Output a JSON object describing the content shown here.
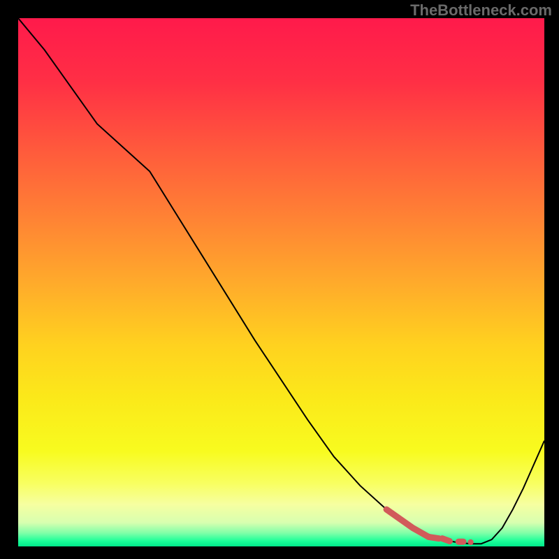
{
  "watermark": "TheBottleneck.com",
  "chart_data": {
    "type": "line",
    "title": "",
    "xlabel": "",
    "ylabel": "",
    "xlim": [
      0,
      100
    ],
    "ylim": [
      0,
      100
    ],
    "series": [
      {
        "name": "curve",
        "color": "#000000",
        "x": [
          0,
          5,
          10,
          15,
          20,
          25,
          30,
          35,
          40,
          45,
          50,
          55,
          60,
          65,
          70,
          75,
          80,
          82,
          84,
          86,
          88,
          90,
          92,
          94,
          96,
          98,
          100
        ],
        "y": [
          100,
          94,
          87,
          80,
          75.5,
          71,
          63,
          55,
          47,
          39,
          31.5,
          24,
          17,
          11.5,
          7,
          3.5,
          1.5,
          1.0,
          0.7,
          0.5,
          0.5,
          1.3,
          3.5,
          7,
          11,
          15.5,
          20
        ]
      },
      {
        "name": "highlight-dash",
        "color": "#d15a5a",
        "stroke_width": 9,
        "x": [
          70,
          75,
          78,
          80,
          82,
          84,
          86
        ],
        "y": [
          7,
          3.5,
          1.8,
          1.5,
          1.0,
          0.9,
          0.8
        ]
      }
    ],
    "background_gradient": {
      "stops": [
        {
          "offset": 0.0,
          "color": "#ff1a4b"
        },
        {
          "offset": 0.12,
          "color": "#ff2f45"
        },
        {
          "offset": 0.25,
          "color": "#ff5a3c"
        },
        {
          "offset": 0.38,
          "color": "#ff8334"
        },
        {
          "offset": 0.5,
          "color": "#ffaa2b"
        },
        {
          "offset": 0.62,
          "color": "#ffd21f"
        },
        {
          "offset": 0.72,
          "color": "#fbe91a"
        },
        {
          "offset": 0.82,
          "color": "#f8fb1f"
        },
        {
          "offset": 0.88,
          "color": "#f8ff60"
        },
        {
          "offset": 0.92,
          "color": "#f6ffa0"
        },
        {
          "offset": 0.955,
          "color": "#d8ffb0"
        },
        {
          "offset": 0.975,
          "color": "#7effa8"
        },
        {
          "offset": 0.99,
          "color": "#1aff99"
        },
        {
          "offset": 1.0,
          "color": "#00e88a"
        }
      ]
    }
  }
}
